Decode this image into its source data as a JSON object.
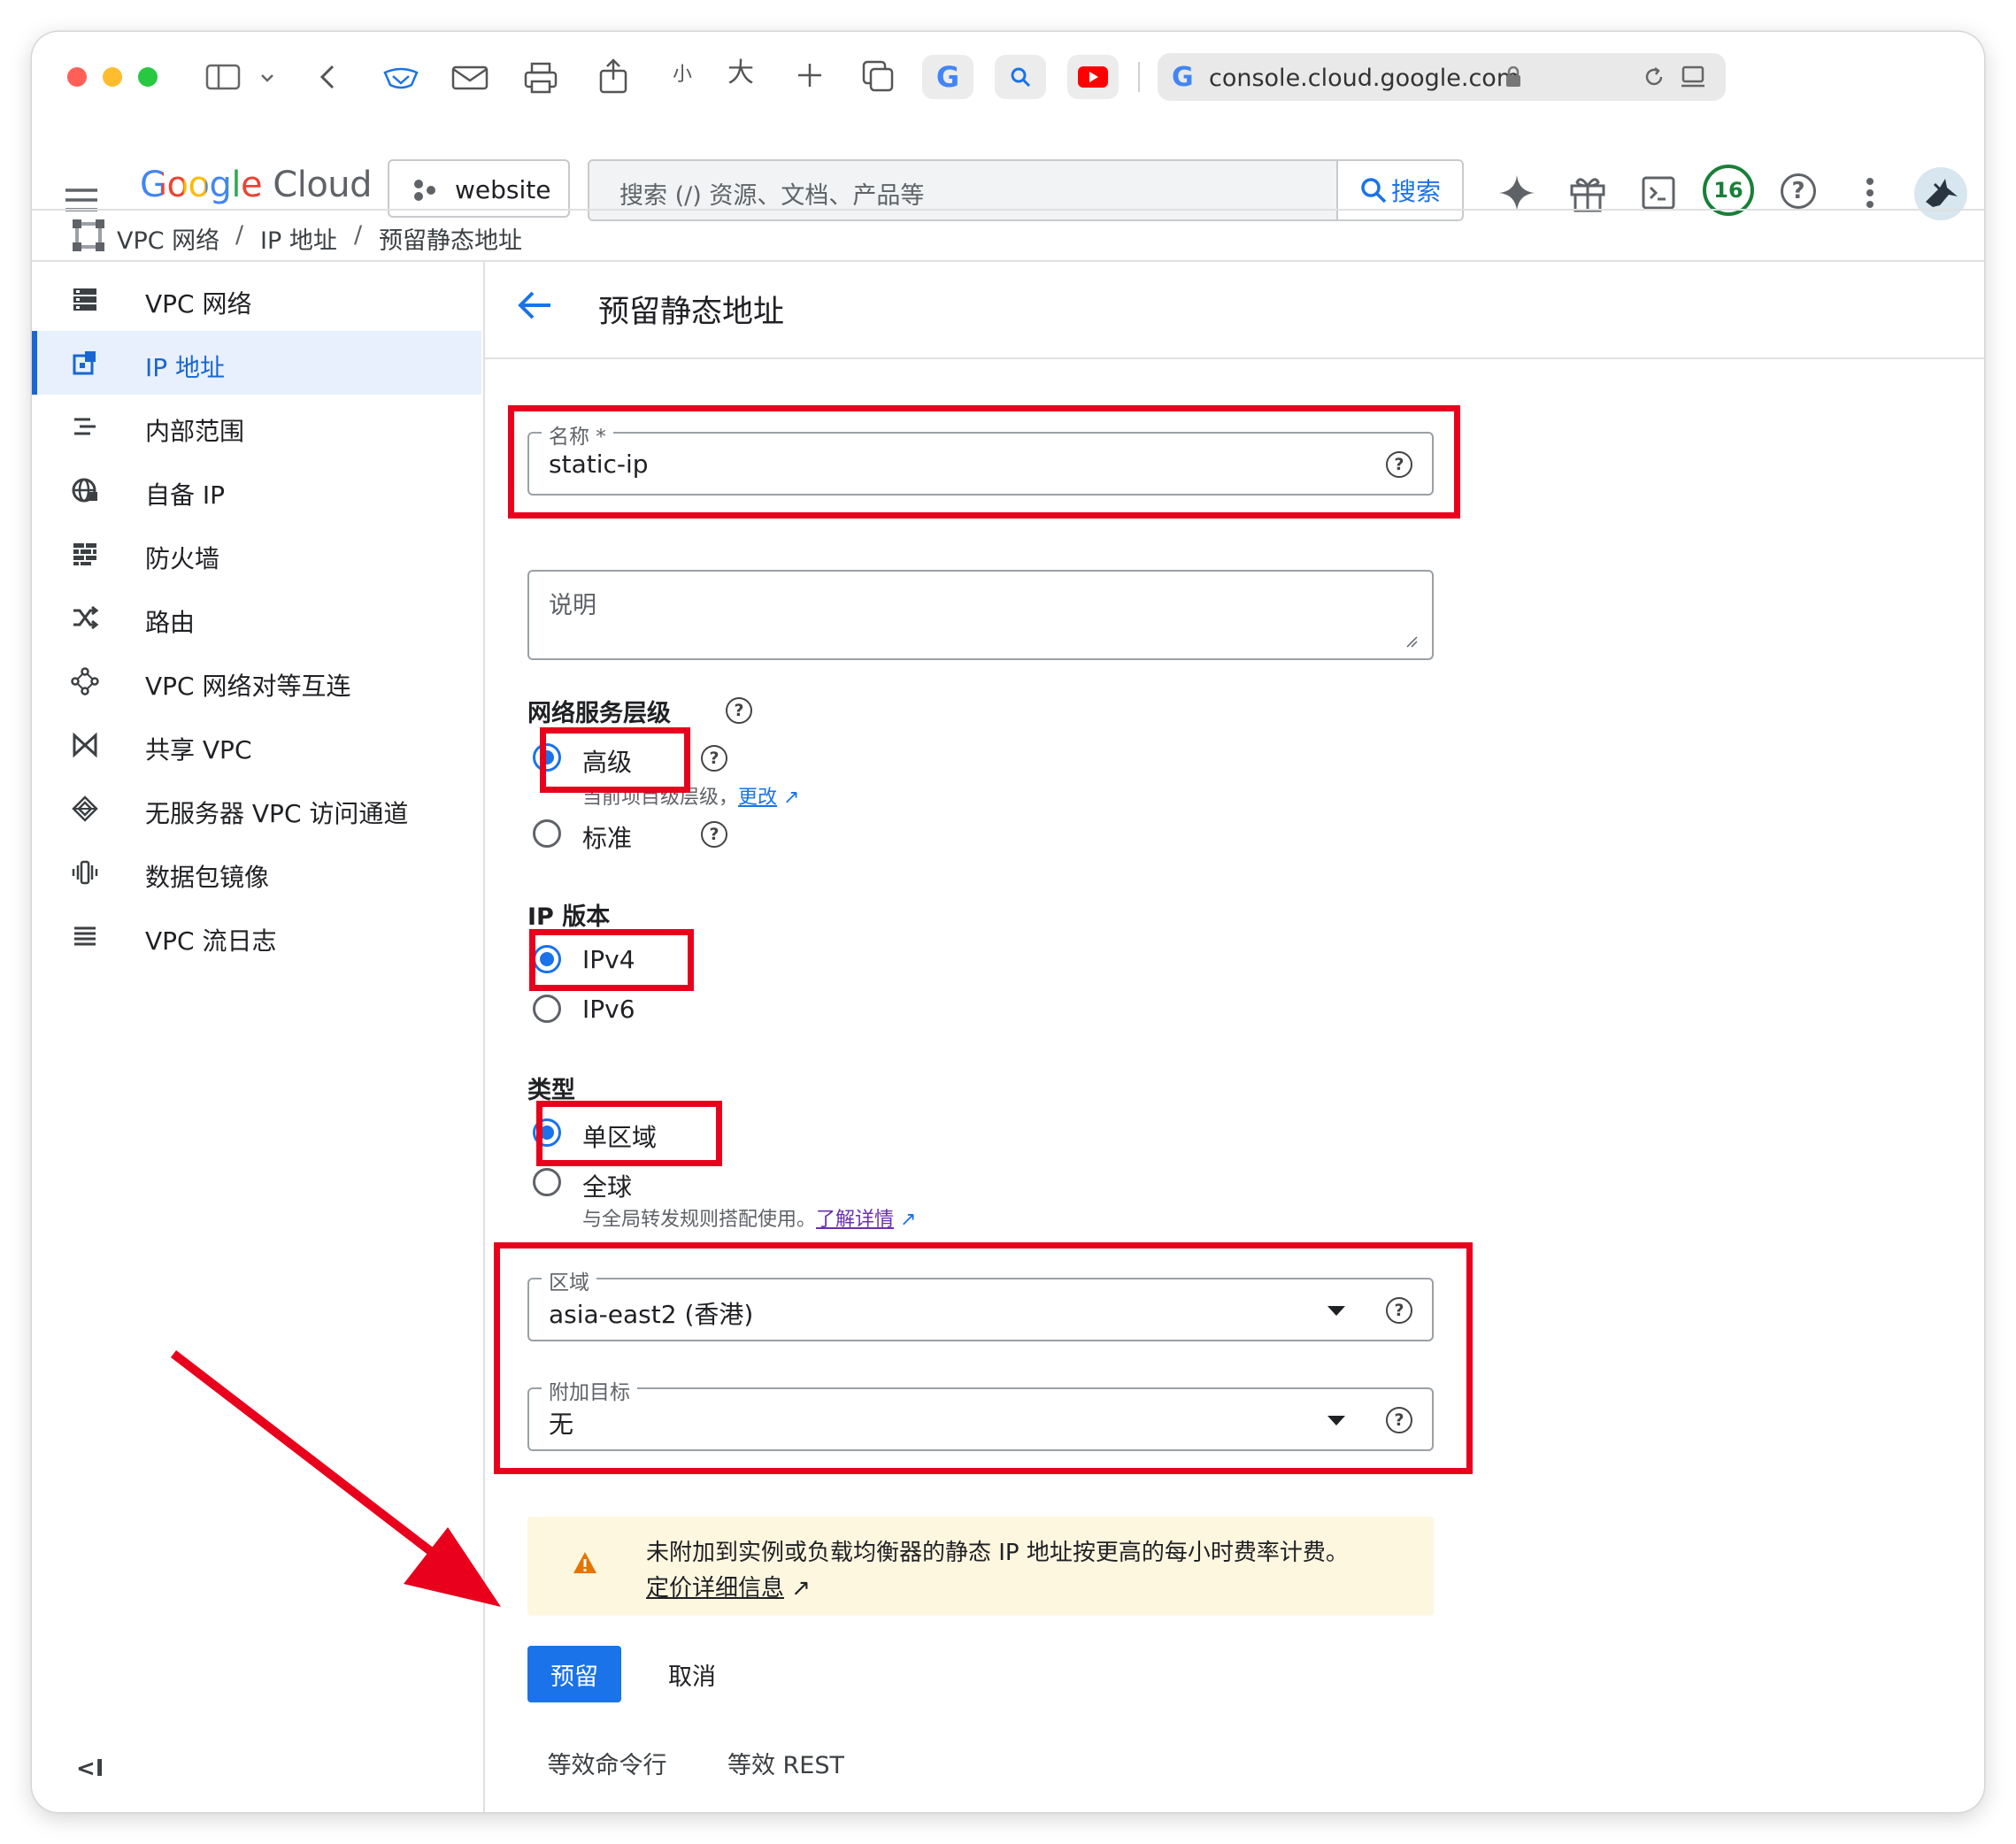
{
  "browser": {
    "tab_small": "小",
    "tab_large": "大",
    "url": "console.cloud.google.com"
  },
  "topbar": {
    "logo_google": "Google",
    "logo_cloud": "Cloud",
    "project": "website",
    "search_placeholder": "搜索 (/) 资源、文档、产品等",
    "search_button": "搜索",
    "notification_count": "16"
  },
  "breadcrumb": {
    "items": [
      "VPC 网络",
      "IP 地址",
      "预留静态地址"
    ],
    "separator": "/"
  },
  "sidebar": {
    "items": [
      {
        "label": "VPC 网络",
        "icon": "vpc-network-icon"
      },
      {
        "label": "IP 地址",
        "icon": "ip-address-icon",
        "active": true
      },
      {
        "label": "内部范围",
        "icon": "internal-ranges-icon"
      },
      {
        "label": "自备 IP",
        "icon": "globe-icon"
      },
      {
        "label": "防火墙",
        "icon": "firewall-icon"
      },
      {
        "label": "路由",
        "icon": "routes-icon"
      },
      {
        "label": "VPC 网络对等互连",
        "icon": "peering-icon"
      },
      {
        "label": "共享 VPC",
        "icon": "shared-vpc-icon"
      },
      {
        "label": "无服务器 VPC 访问通道",
        "icon": "serverless-icon"
      },
      {
        "label": "数据包镜像",
        "icon": "packet-mirroring-icon"
      },
      {
        "label": "VPC 流日志",
        "icon": "flow-logs-icon"
      }
    ],
    "collapse_label": "<I"
  },
  "page": {
    "title": "预留静态地址",
    "name_field": {
      "label": "名称 *",
      "value": "static-ip"
    },
    "description_field": {
      "placeholder": "说明"
    },
    "network_tier": {
      "title": "网络服务层级",
      "premium": "高级",
      "premium_hint": "当前项目级层级，",
      "change_link": "更改",
      "standard": "标准",
      "selected": "高级"
    },
    "ip_version": {
      "title": "IP 版本",
      "ipv4": "IPv4",
      "ipv6": "IPv6",
      "selected": "IPv4"
    },
    "type": {
      "title": "类型",
      "regional": "单区域",
      "global": "全球",
      "global_hint": "与全局转发规则搭配使用。",
      "learn_more": "了解详情",
      "selected": "单区域"
    },
    "region_field": {
      "label": "区域",
      "value": "asia-east2 (香港)"
    },
    "attach_field": {
      "label": "附加目标",
      "value": "无"
    },
    "warning": {
      "text": "未附加到实例或负载均衡器的静态 IP 地址按更高的每小时费率计费。",
      "link": "定价详细信息"
    },
    "buttons": {
      "reserve": "预留",
      "cancel": "取消"
    },
    "equivalent": {
      "command_line": "等效命令行",
      "rest": "等效 REST"
    }
  },
  "colors": {
    "accent": "#1a73e8",
    "annotation_red": "#e8001c",
    "warning_bg": "#fef7e0",
    "warning_icon": "#e37400",
    "notification_green": "#188038"
  }
}
